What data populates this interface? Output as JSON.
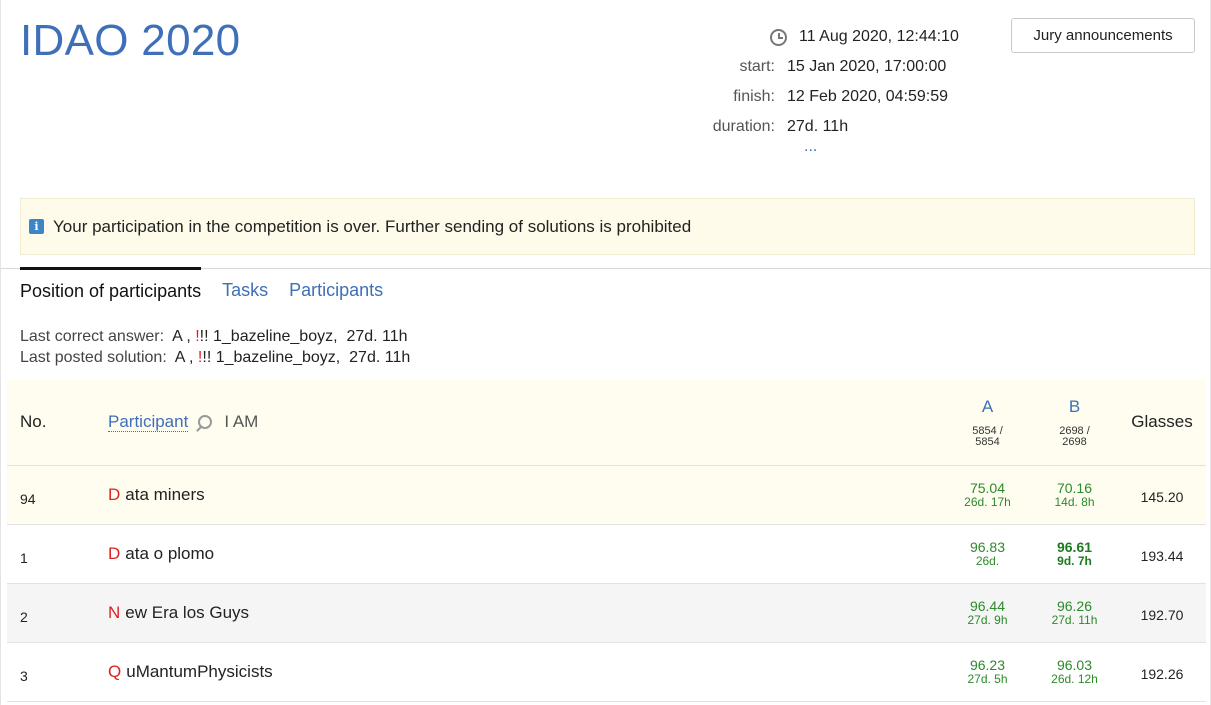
{
  "contest": {
    "title": "IDAO 2020",
    "current_time": "11 Aug 2020, 12:44:10",
    "start_label": "start:",
    "start_value": "15 Jan 2020, 17:00:00",
    "finish_label": "finish:",
    "finish_value": "12 Feb 2020, 04:59:59",
    "duration_label": "duration:",
    "duration_value": "27d. 11h",
    "more": "...",
    "jury_button": "Jury announcements"
  },
  "notice": {
    "icon": "info-icon",
    "text": "Your participation in the competition is over. Further sending of solutions is prohibited"
  },
  "tabs": [
    {
      "label": "Position of participants",
      "active": true
    },
    {
      "label": "Tasks",
      "active": false
    },
    {
      "label": "Participants",
      "active": false
    }
  ],
  "last": {
    "correct_label": "Last correct answer:",
    "correct_task": "A ,",
    "correct_excl": "!",
    "correct_team": "!! 1_bazeline_boyz,",
    "correct_time": "27d. 11h",
    "posted_label": "Last posted solution:",
    "posted_task": "A ,",
    "posted_excl": "!",
    "posted_team": "!! 1_bazeline_boyz,",
    "posted_time": "27d. 11h"
  },
  "table": {
    "col_no": "No.",
    "col_participant": "Participant",
    "i_am": "I AM",
    "task_a": "A",
    "task_a_stat1": "5854 /",
    "task_a_stat2": "5854",
    "task_b": "B",
    "task_b_stat1": "2698 /",
    "task_b_stat2": "2698",
    "col_glasses": "Glasses",
    "rows": [
      {
        "no": "94",
        "initial": "D",
        "name": "ata miners",
        "a_pts": "75.04",
        "a_time": "26d. 17h",
        "b_pts": "70.16",
        "b_time": "14d. 8h",
        "glasses": "145.20"
      },
      {
        "no": "1",
        "initial": "D",
        "name": "ata o plomo",
        "a_pts": "96.83",
        "a_time": "26d.",
        "b_pts": "96.61",
        "b_time": "9d. 7h",
        "glasses": "193.44"
      },
      {
        "no": "2",
        "initial": "N",
        "name": "ew Era los Guys",
        "a_pts": "96.44",
        "a_time": "27d. 9h",
        "b_pts": "96.26",
        "b_time": "27d. 11h",
        "glasses": "192.70"
      },
      {
        "no": "3",
        "initial": "Q",
        "name": "uMantumPhysicists",
        "a_pts": "96.23",
        "a_time": "27d. 5h",
        "b_pts": "96.03",
        "b_time": "26d. 12h",
        "glasses": "192.26"
      }
    ]
  }
}
